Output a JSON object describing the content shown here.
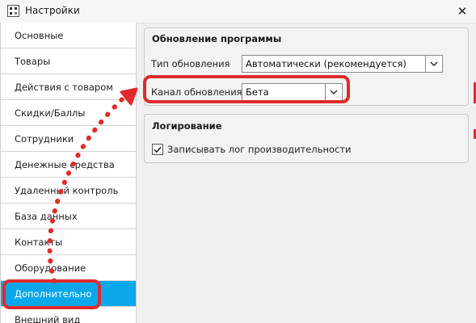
{
  "window": {
    "title": "Настройки",
    "close_symbol": "✕"
  },
  "sidebar": {
    "items": [
      {
        "label": "Основные"
      },
      {
        "label": "Товары"
      },
      {
        "label": "Действия с товаром"
      },
      {
        "label": "Скидки/Баллы"
      },
      {
        "label": "Сотрудники"
      },
      {
        "label": "Денежные средства"
      },
      {
        "label": "Удаленный контроль"
      },
      {
        "label": "База данных"
      },
      {
        "label": "Контакты"
      },
      {
        "label": "Оборудование"
      },
      {
        "label": "Дополнительно"
      },
      {
        "label": "Внешний вид"
      }
    ],
    "selected": "Дополнительно"
  },
  "update_group": {
    "title": "Обновление программы",
    "type_label": "Тип обновления",
    "type_value": "Автоматически (рекомендуется)",
    "channel_label": "Канал обновления",
    "channel_value": "Бета"
  },
  "logging_group": {
    "title": "Логирование",
    "perf_log_label": "Записывать лог производительности",
    "perf_log_checked": true
  },
  "annotation": {
    "color": "#e02b2b"
  },
  "colors": {
    "selected_bg": "#0aa8ea",
    "selected_fg": "#ffffff"
  }
}
